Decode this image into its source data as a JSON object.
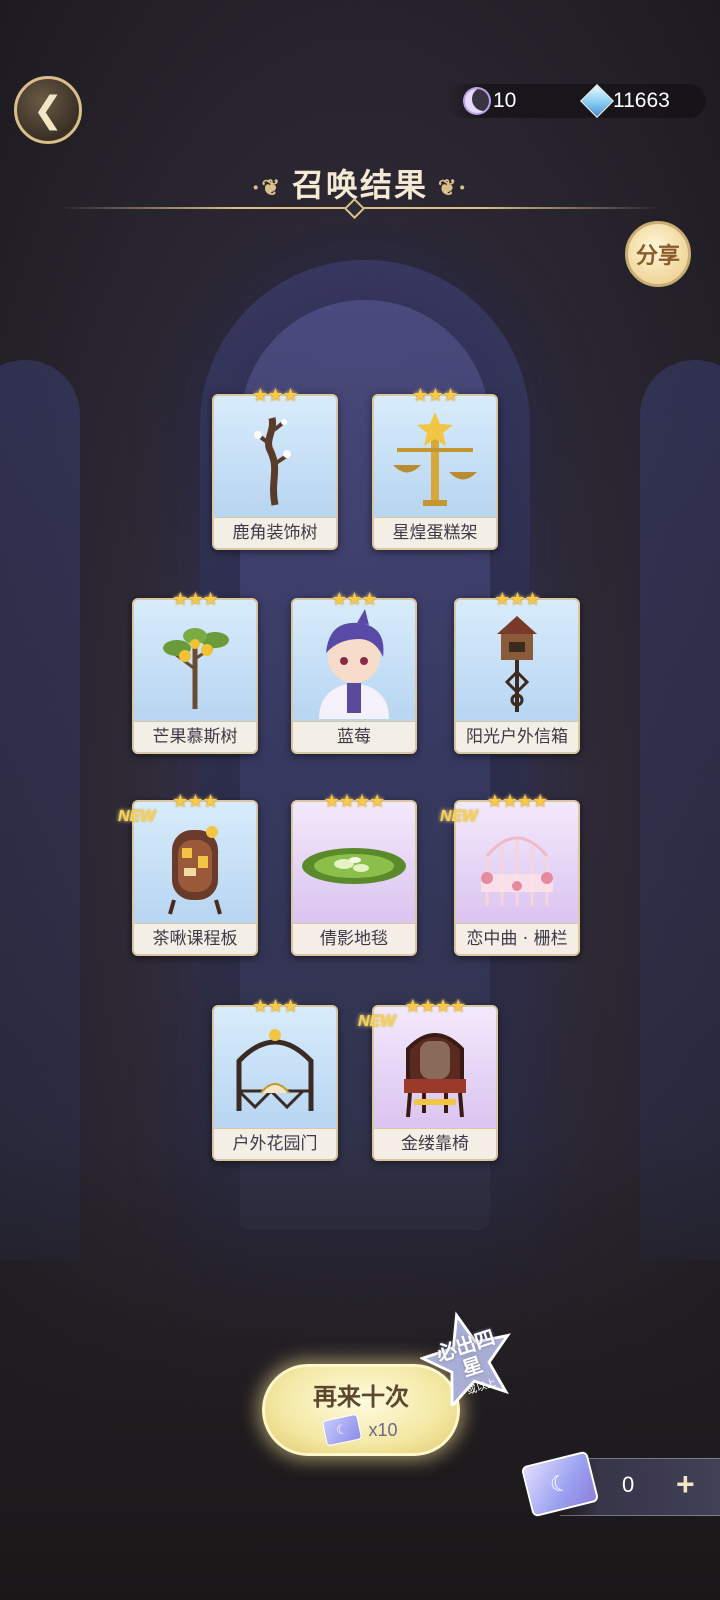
{
  "header": {
    "title": "召唤结果",
    "moon_currency": "10",
    "gem_currency": "11663",
    "share_label": "分享"
  },
  "cards": [
    {
      "name": "鹿角装饰树",
      "stars": "★★★",
      "new": "",
      "bg": "blue",
      "icon": "antler-tree-icon"
    },
    {
      "name": "星煌蛋糕架",
      "stars": "★★★",
      "new": "",
      "bg": "blue",
      "icon": "star-cake-stand-icon"
    },
    {
      "name": "芒果慕斯树",
      "stars": "★★★",
      "new": "",
      "bg": "blue",
      "icon": "mango-tree-icon"
    },
    {
      "name": "蓝莓",
      "stars": "★★★",
      "new": "",
      "bg": "blue",
      "icon": "character-portrait-icon"
    },
    {
      "name": "阳光户外信箱",
      "stars": "★★★",
      "new": "",
      "bg": "blue",
      "icon": "mailbox-icon"
    },
    {
      "name": "茶啾课程板",
      "stars": "★★★",
      "new": "NEW",
      "bg": "blue",
      "icon": "schedule-board-icon"
    },
    {
      "name": "倩影地毯",
      "stars": "★★★★",
      "new": "",
      "bg": "purple",
      "icon": "rug-icon"
    },
    {
      "name": "恋中曲 · 栅栏",
      "stars": "★★★★",
      "new": "NEW",
      "bg": "purple",
      "icon": "fence-icon"
    },
    {
      "name": "户外花园门",
      "stars": "★★★",
      "new": "",
      "bg": "blue",
      "icon": "garden-gate-icon"
    },
    {
      "name": "金缕靠椅",
      "stars": "★★★★",
      "new": "NEW",
      "bg": "purple",
      "icon": "armchair-icon"
    }
  ],
  "footer": {
    "again_label": "再来十次",
    "again_cost": "x10",
    "badge_text": "必出四星",
    "badge_sub": "或以上",
    "ticket_count": "0",
    "plus_label": "+"
  }
}
